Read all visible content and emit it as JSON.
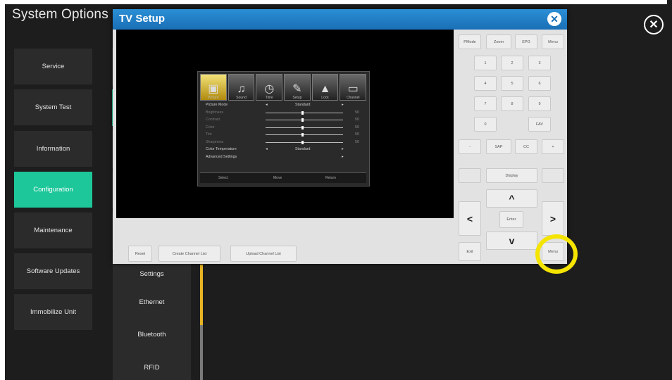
{
  "app_title": "System Options",
  "menu": [
    {
      "label": "Service"
    },
    {
      "label": "System Test"
    },
    {
      "label": "Information"
    },
    {
      "label": "Configuration"
    },
    {
      "label": "Maintenance"
    },
    {
      "label": "Software Updates"
    },
    {
      "label": "Immobilize Unit"
    }
  ],
  "submenu": [
    {
      "label": "Settings"
    },
    {
      "label": "Ethernet"
    },
    {
      "label": "Bluetooth"
    },
    {
      "label": "RFID"
    }
  ],
  "dialog": {
    "title": "TV Setup",
    "close_icon": "close-icon",
    "footer_buttons": [
      "Reset",
      "Create Channel List",
      "Upload Channel List"
    ]
  },
  "osd": {
    "icons": [
      {
        "name": "picture-icon",
        "label": "Picture"
      },
      {
        "name": "sound-icon",
        "label": "Sound"
      },
      {
        "name": "time-icon",
        "label": "Time"
      },
      {
        "name": "setup-icon",
        "label": "Setup"
      },
      {
        "name": "lock-icon",
        "label": "Lock"
      },
      {
        "name": "channel-icon",
        "label": "Channel"
      }
    ],
    "rows": [
      {
        "label": "Picture Mode",
        "value": "Standard"
      },
      {
        "label": "Brightness",
        "number": "50"
      },
      {
        "label": "Contrast",
        "number": "50"
      },
      {
        "label": "Color",
        "number": "50"
      },
      {
        "label": "Tint",
        "number": "50"
      },
      {
        "label": "Sharpness",
        "number": "50"
      },
      {
        "label": "Color Temperature",
        "value": "Standard"
      },
      {
        "label": "Advanced Settings"
      }
    ],
    "footer": [
      "Select",
      "Move",
      "Return"
    ]
  },
  "remote": {
    "top_row": [
      "PMode",
      "Zoom",
      "EPG",
      "Menu"
    ],
    "digits": [
      "1",
      "2",
      "3",
      "4",
      "5",
      "6",
      "7",
      "8",
      "9",
      "0"
    ],
    "fav": "FAV",
    "minus": "-",
    "plus": "+",
    "sap": "SAP",
    "cc": "CC",
    "display": "Display",
    "enter": "Enter",
    "exit": "Exit",
    "menu_bottom": "Menu",
    "arrows": {
      "up": "^",
      "down": "v",
      "left": "<",
      "right": ">"
    }
  },
  "colors": {
    "accent": "#1ec79a",
    "titlebar": "#1a6fb5",
    "highlight": "#f5e400",
    "scrollbar": "#e6b422"
  }
}
